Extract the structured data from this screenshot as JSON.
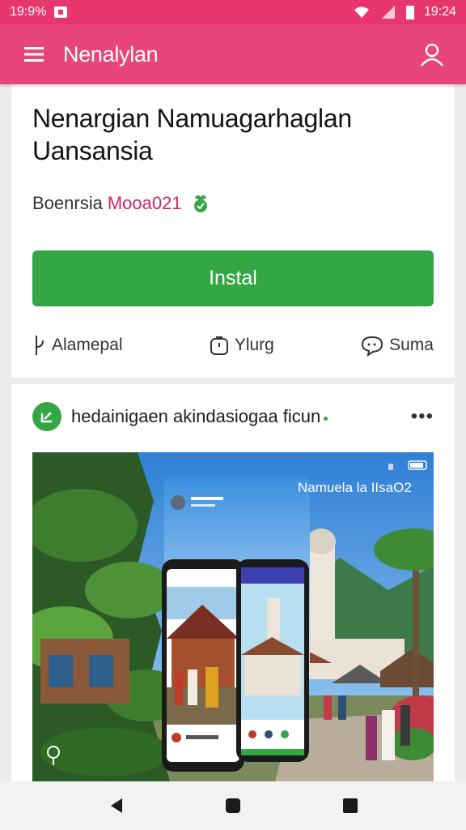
{
  "status_bar": {
    "left_text": "19:9%",
    "time": "19:24",
    "icons": [
      "notification-square-icon",
      "wifi-icon",
      "cell-signal-icon",
      "battery-icon"
    ]
  },
  "app_bar": {
    "title": "Nenalylan",
    "icons": [
      "menu-icon",
      "account-icon"
    ]
  },
  "app": {
    "title": "Nenargian Namuagarhaglan Uansansia",
    "developer": "Boenrsia",
    "developer_sub": "Mooa021",
    "install_label": "Instal",
    "meta": [
      {
        "icon": "tag-icon",
        "label": "Alamepal"
      },
      {
        "icon": "timer-icon",
        "label": "Ylurg"
      },
      {
        "icon": "chat-icon",
        "label": "Suma"
      }
    ]
  },
  "post": {
    "title": "hedainigaen akindasiogaa ficun",
    "more_label": "•••",
    "image_caption": "Namuela la IIsaO2"
  },
  "colors": {
    "brand_pink": "#e8457a",
    "install_green": "#34a643",
    "developer_accent": "#d0245c"
  },
  "nav_bar": {
    "icons": [
      "back-icon",
      "home-icon",
      "recents-icon"
    ]
  }
}
